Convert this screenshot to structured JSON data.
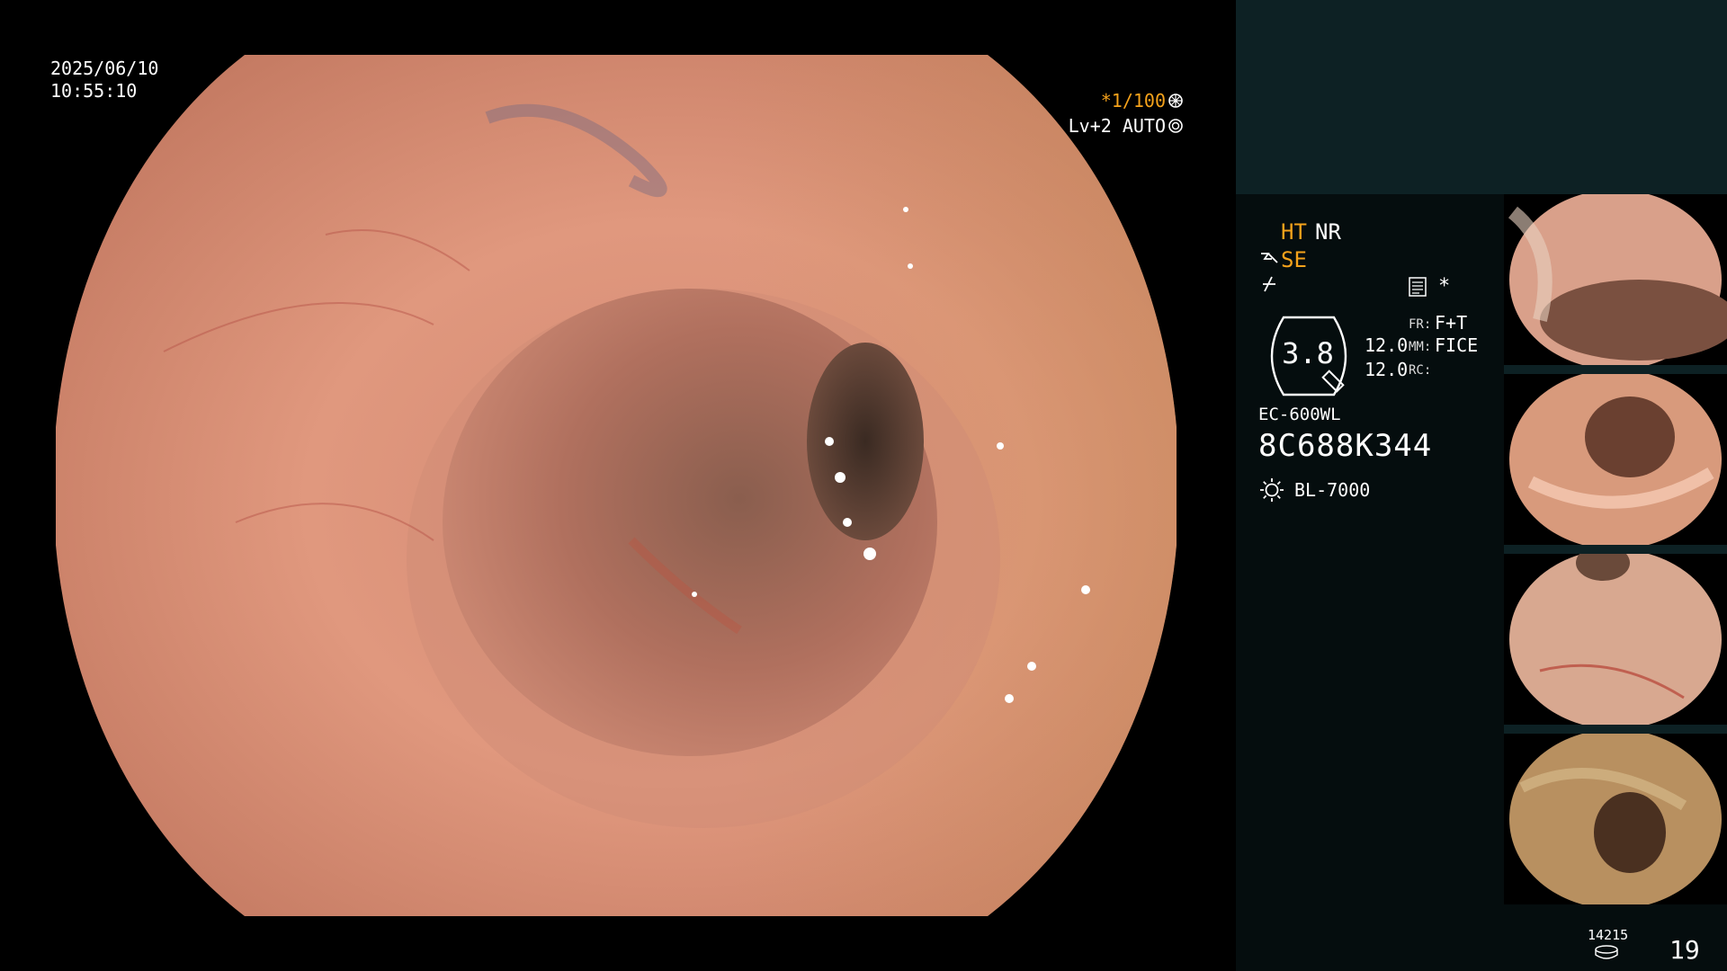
{
  "overlay": {
    "date": "2025/06/10",
    "time": "10:55:10",
    "shutter": "*1/100",
    "level": "Lv+2 AUTO"
  },
  "panel": {
    "ht": "HT",
    "nr": "NR",
    "se": "SE",
    "star": "*",
    "zoom": "3.8",
    "val_a": "12.0",
    "val_b": "12.0",
    "fr_key": "FR:",
    "fr_value": "F+T",
    "mm_key": "MM:",
    "mm_value": "FICE",
    "rc_key": "RC:",
    "model": "EC-600WL",
    "serial": "8C688K344",
    "light_source": "BL-7000",
    "image_count": "14215",
    "page": "19"
  },
  "colors": {
    "accent_orange": "#f5a21b",
    "panel_top": "#0d2124",
    "panel_bg": "#050d0e"
  }
}
